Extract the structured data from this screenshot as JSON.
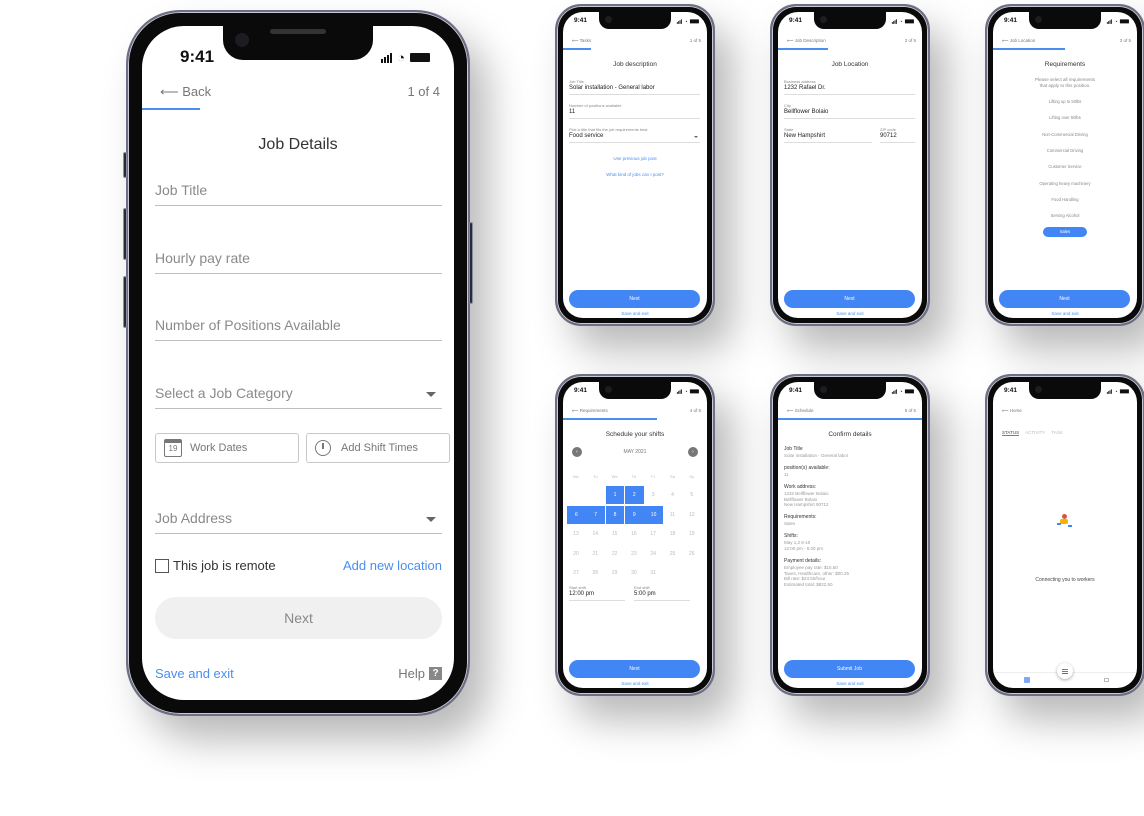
{
  "status_time": "9:41",
  "main_phone": {
    "back_label": "Back",
    "step": "1 of 4",
    "title": "Job Details",
    "fields": {
      "job_title_placeholder": "Job Title",
      "pay_rate_placeholder": "Hourly pay rate",
      "positions_placeholder": "Number of Positions Available",
      "category_placeholder": "Select a Job Category",
      "address_placeholder": "Job Address"
    },
    "work_dates_label": "Work Dates",
    "calendar_icon_number": "19",
    "shift_times_label": "Add Shift Times",
    "remote_label": "This job is remote",
    "remote_checked": false,
    "add_location_label": "Add new location",
    "next_label": "Next",
    "save_exit_label": "Save and exit",
    "help_label": "Help",
    "help_icon": "?"
  },
  "screens": {
    "job_description": {
      "back_label": "Tasks",
      "step": "1 of 5",
      "title": "Job description",
      "job_title_label": "Job Title",
      "job_title_value": "Solar installation - General labor",
      "positions_label": "Number of positions available",
      "positions_value": "11",
      "pick_label": "Pick a title that fits the job requirements best",
      "pick_value": "Food service",
      "use_previous_link": "Use previous job post",
      "what_jobs_link": "What kind of jobs can I post?",
      "next_label": "Next",
      "save_exit_label": "Save and exit"
    },
    "job_location": {
      "back_label": "Job Description",
      "step": "2 of 5",
      "title": "Job Location",
      "business_label": "Business address",
      "business_value": "1232 Rafael Dr.",
      "city_label": "City",
      "city_value": "Bellflower Bolaio",
      "state_label": "State",
      "state_value": "New Hampshirt",
      "zip_label": "ZIP code",
      "zip_value": "90712",
      "next_label": "Next",
      "save_exit_label": "Save and exit"
    },
    "requirements": {
      "back_label": "Job Location",
      "step": "3 of 5",
      "title": "Requirements",
      "subtitle_1": "Please select all requirements",
      "subtitle_2": "that apply to this position.",
      "items": [
        {
          "label": "Lifting up to 50lbs",
          "selected": false
        },
        {
          "label": "Lifting over 50lbs",
          "selected": false
        },
        {
          "label": "Non-Commercial Driving",
          "selected": false
        },
        {
          "label": "Commercial Driving",
          "selected": false
        },
        {
          "label": "Customer Service",
          "selected": false
        },
        {
          "label": "Operating heavy machinery",
          "selected": false
        },
        {
          "label": "Food Handling",
          "selected": false
        },
        {
          "label": "Serving Alcohol",
          "selected": false
        },
        {
          "label": "Sales",
          "selected": true
        }
      ],
      "next_label": "Next",
      "save_exit_label": "Save and exit"
    },
    "schedule": {
      "back_label": "Requirements",
      "step": "4 of 5",
      "title": "Schedule your shifts",
      "month": "MAY 2021",
      "weekdays": [
        "Mo",
        "Tu",
        "We",
        "Th",
        "Fr",
        "Sa",
        "Su"
      ],
      "weeks": [
        [
          "",
          "",
          "1",
          "2",
          "3",
          "4",
          "5"
        ],
        [
          "6",
          "7",
          "8",
          "9",
          "10",
          "11",
          "12"
        ],
        [
          "13",
          "14",
          "15",
          "16",
          "17",
          "18",
          "19"
        ],
        [
          "20",
          "21",
          "22",
          "23",
          "24",
          "25",
          "26"
        ],
        [
          "27",
          "28",
          "29",
          "30",
          "31",
          "",
          ""
        ]
      ],
      "selected_days": [
        "1",
        "2",
        "6",
        "7",
        "8",
        "9",
        "10"
      ],
      "start_label": "Start shift",
      "start_value": "12:00 pm",
      "end_label": "End shift",
      "end_value": "5:00 pm",
      "next_label": "Next",
      "save_exit_label": "Save and exit"
    },
    "confirm": {
      "back_label": "Schedule",
      "step": "5 of 5",
      "title": "Confirm details",
      "sections": [
        {
          "heading": "Job Title",
          "lines": [
            "Solar installation - General labor"
          ]
        },
        {
          "heading": "position(s) available:",
          "lines": [
            "11"
          ]
        },
        {
          "heading": "Work address:",
          "lines": [
            "1232 Bellflower Bolaio",
            "Bellflower Bolaio",
            "New Hampshirt 90712"
          ]
        },
        {
          "heading": "Requirements:",
          "lines": [
            "Sales"
          ]
        },
        {
          "heading": "Shifts:",
          "lines": [
            "May 1,2 6-10",
            "12:00 pm - 5:00 pm"
          ]
        },
        {
          "heading": "Payment details:",
          "lines": [
            "Employee pay rate: $15.50",
            "Taxes, Healthcare, other: $00.25",
            "Bill rate: $23.50/hour",
            "Estimated total: $822.50"
          ]
        }
      ],
      "submit_label": "Submit Job",
      "save_exit_label": "Save and exit"
    },
    "home": {
      "back_label": "Home",
      "tabs": [
        {
          "label": "STATUS",
          "active": true
        },
        {
          "label": "ACTIVITY",
          "active": false
        },
        {
          "label": "TASK",
          "active": false
        }
      ],
      "status_message": "Connecting you to workers"
    }
  },
  "colors": {
    "accent": "#4285f4",
    "link": "#4a8ff0",
    "frame": "#0a0a0a"
  }
}
